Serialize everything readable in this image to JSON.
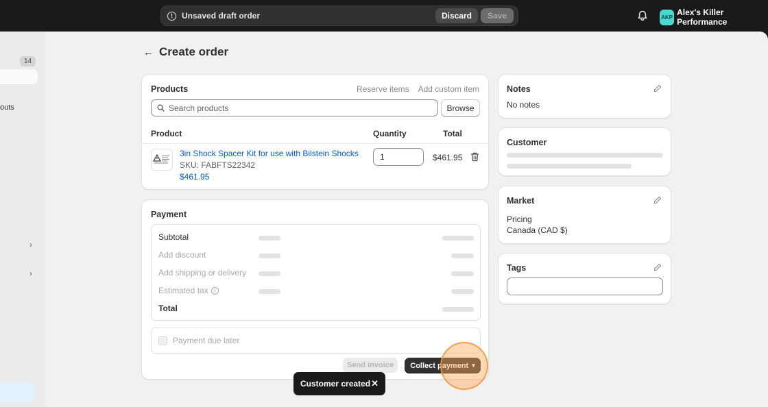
{
  "topbar": {
    "draft_text": "Unsaved draft order",
    "discard_label": "Discard",
    "save_label": "Save",
    "store_initials": "AKP",
    "store_name": "Alex's Killer Performance",
    "avatar_color": "#4ad8d0"
  },
  "sidebar": {
    "badge_count": "14",
    "partial_label": "outs"
  },
  "header": {
    "title": "Create order"
  },
  "products": {
    "title": "Products",
    "reserve_label": "Reserve items",
    "add_custom_label": "Add custom item",
    "search_placeholder": "Search products",
    "browse_label": "Browse",
    "columns": [
      "Product",
      "Quantity",
      "Total"
    ],
    "items": [
      {
        "name": "3in Shock Spacer Kit for use with Bilstein Shocks",
        "sku": "SKU: FABFTS22342",
        "price": "$461.95",
        "quantity": "1",
        "total": "$461.95"
      }
    ]
  },
  "payment": {
    "title": "Payment",
    "rows": [
      "Subtotal",
      "Add discount",
      "Add shipping or delivery",
      "Estimated tax",
      "Total"
    ],
    "due_later_label": "Payment due later",
    "send_invoice_label": "Send invoice",
    "collect_label": "Collect payment"
  },
  "notes": {
    "title": "Notes",
    "value": "No notes"
  },
  "customer": {
    "title": "Customer"
  },
  "market": {
    "title": "Market",
    "pricing_label": "Pricing",
    "pricing_value": "Canada (CAD $)"
  },
  "tags": {
    "title": "Tags"
  },
  "toast": {
    "text": "Customer created",
    "close": "✕"
  },
  "colors": {
    "link": "#005bd3",
    "primary_button": "#303030",
    "click_highlight": "#f0963c"
  }
}
